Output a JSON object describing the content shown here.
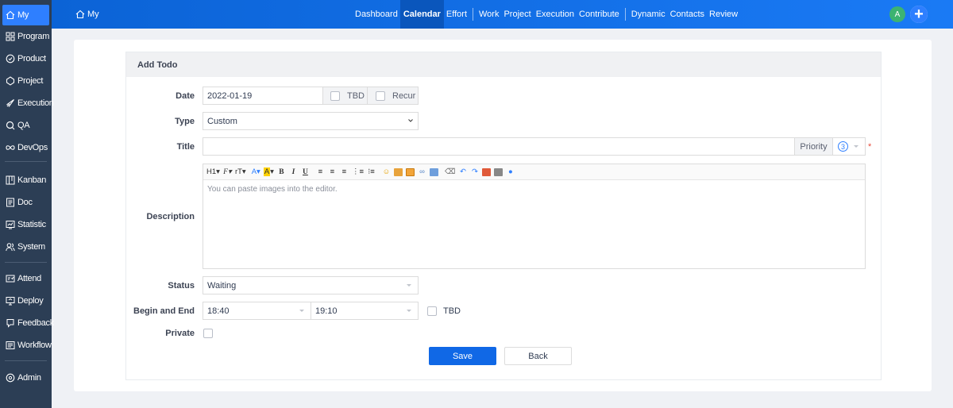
{
  "sidebar": {
    "items": [
      {
        "label": "My",
        "icon": "home-icon"
      },
      {
        "label": "Program",
        "icon": "grid-icon"
      },
      {
        "label": "Product",
        "icon": "product-icon"
      },
      {
        "label": "Project",
        "icon": "project-icon"
      },
      {
        "label": "Execution",
        "icon": "rocket-icon"
      },
      {
        "label": "QA",
        "icon": "qa-icon"
      },
      {
        "label": "DevOps",
        "icon": "infinity-icon"
      },
      {
        "label": "Kanban",
        "icon": "kanban-icon"
      },
      {
        "label": "Doc",
        "icon": "doc-icon"
      },
      {
        "label": "Statistic",
        "icon": "statistic-icon"
      },
      {
        "label": "System",
        "icon": "system-icon"
      },
      {
        "label": "Attend",
        "icon": "attend-icon"
      },
      {
        "label": "Deploy",
        "icon": "deploy-icon"
      },
      {
        "label": "Feedback",
        "icon": "feedback-icon"
      },
      {
        "label": "Workflow",
        "icon": "workflow-icon"
      },
      {
        "label": "Admin",
        "icon": "admin-icon"
      }
    ]
  },
  "header": {
    "home_label": "My",
    "nav": [
      "Dashboard",
      "Calendar",
      "Effort",
      "Work",
      "Project",
      "Execution",
      "Contribute",
      "Dynamic",
      "Contacts",
      "Review"
    ],
    "avatar_initial": "A"
  },
  "form": {
    "title": "Add Todo",
    "date_label": "Date",
    "date_value": "2022-01-19",
    "tbd_label": "TBD",
    "recur_label": "Recur",
    "type_label": "Type",
    "type_value": "Custom",
    "title_label": "Title",
    "title_value": "",
    "priority_label": "Priority",
    "priority_value": "3",
    "description_label": "Description",
    "editor_toolbar": [
      "H1",
      "F",
      "rT",
      "A",
      "A",
      "B",
      "I",
      "U"
    ],
    "editor_placeholder": "You can paste images into the editor.",
    "status_label": "Status",
    "status_value": "Waiting",
    "begin_end_label": "Begin and End",
    "begin_value": "18:40",
    "end_value": "19:10",
    "time_tbd_label": "TBD",
    "private_label": "Private",
    "save_label": "Save",
    "back_label": "Back"
  },
  "colors": {
    "sidebar_bg": "#2c3e55",
    "accent": "#2e7fff",
    "primary_button": "#1068e6",
    "required": "#e74c3c"
  }
}
